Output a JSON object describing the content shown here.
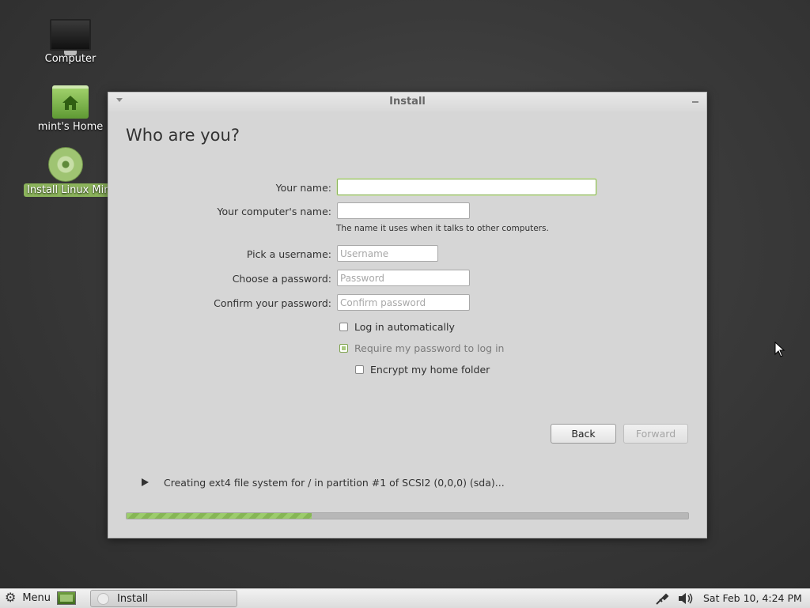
{
  "desktop": {
    "icons": [
      {
        "label": "Computer",
        "icon": "computer-icon"
      },
      {
        "label": "mint's Home",
        "icon": "home-folder-icon"
      },
      {
        "label": "Install Linux Mint",
        "icon": "install-disc-icon"
      }
    ]
  },
  "window": {
    "title": "Install",
    "heading": "Who are you?",
    "fields": {
      "name": {
        "label": "Your name:",
        "value": "",
        "placeholder": ""
      },
      "computer_name": {
        "label": "Your computer's name:",
        "value": "",
        "placeholder": "",
        "hint": "The name it uses when it talks to other computers."
      },
      "username": {
        "label": "Pick a username:",
        "value": "",
        "placeholder": "Username"
      },
      "password": {
        "label": "Choose a password:",
        "value": "",
        "placeholder": "Password"
      },
      "confirm": {
        "label": "Confirm your password:",
        "value": "",
        "placeholder": "Confirm password"
      }
    },
    "options": {
      "auto_login": {
        "label": "Log in automatically",
        "checked": false
      },
      "require_password": {
        "label": "Require my password to log in",
        "checked": true
      },
      "encrypt_home": {
        "label": "Encrypt my home folder",
        "checked": false
      }
    },
    "buttons": {
      "back": "Back",
      "forward": "Forward"
    },
    "status_text": "Creating ext4 file system for / in partition #1 of SCSI2 (0,0,0) (sda)...",
    "progress_fraction": 0.33
  },
  "taskbar": {
    "menu_label": "Menu",
    "task_label": "Install",
    "clock": "Sat Feb 10,  4:24 PM"
  },
  "colors": {
    "accent": "#8bb35b",
    "window_bg": "#d6d6d6",
    "desktop_bg": "#3a3a3a"
  }
}
